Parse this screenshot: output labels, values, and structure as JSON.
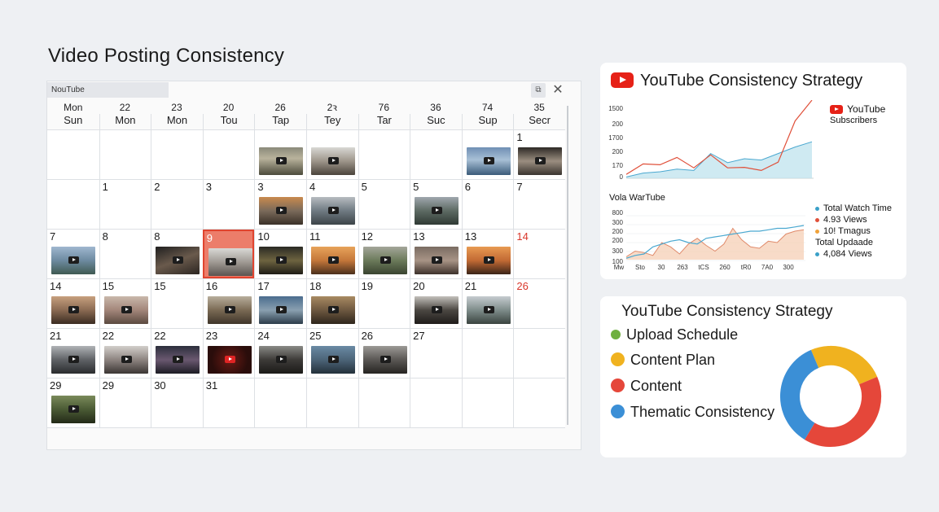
{
  "page_title": "Video Posting Consistency",
  "calendar": {
    "tab_label": "NouTube",
    "restore_label": "⧉",
    "close_label": "✕",
    "header_numbers": [
      "Mon",
      "22",
      "23",
      "20",
      "26",
      "2ꝛ",
      "76",
      "36",
      "74",
      "35"
    ],
    "header_days": [
      "Sun",
      "Mon",
      "Mon",
      "Tou",
      "Tap",
      "Tey",
      "Tar",
      "Suc",
      "Sup",
      "Secr"
    ],
    "weeks": [
      [
        {
          "n": ""
        },
        {
          "n": ""
        },
        {
          "n": ""
        },
        {
          "n": ""
        },
        {
          "n": "",
          "t": "a"
        },
        {
          "n": "",
          "t": "b"
        },
        {
          "n": ""
        },
        {
          "n": ""
        },
        {
          "n": "",
          "t": "c"
        },
        {
          "n": "1",
          "t": "d"
        }
      ],
      [
        {
          "n": ""
        },
        {
          "n": "1"
        },
        {
          "n": "2"
        },
        {
          "n": "3"
        },
        {
          "n": "3",
          "t": "e"
        },
        {
          "n": "4",
          "t": "f"
        },
        {
          "n": "5"
        },
        {
          "n": "5",
          "t": "g"
        },
        {
          "n": "6"
        },
        {
          "n": "7"
        }
      ],
      [
        {
          "n": "7",
          "t": "h"
        },
        {
          "n": "8"
        },
        {
          "n": "8",
          "t": "i"
        },
        {
          "n": "9",
          "t": "j",
          "hl": true
        },
        {
          "n": "10",
          "t": "k"
        },
        {
          "n": "11",
          "t": "l"
        },
        {
          "n": "12",
          "t": "m"
        },
        {
          "n": "13",
          "t": "n"
        },
        {
          "n": "13",
          "t": "o"
        },
        {
          "n": "14",
          "red": true
        }
      ],
      [
        {
          "n": "14",
          "t": "p"
        },
        {
          "n": "15",
          "t": "q"
        },
        {
          "n": "15"
        },
        {
          "n": "16",
          "t": "r"
        },
        {
          "n": "17",
          "t": "s"
        },
        {
          "n": "18",
          "t": "t"
        },
        {
          "n": "19"
        },
        {
          "n": "20",
          "t": "u"
        },
        {
          "n": "21",
          "t": "v"
        },
        {
          "n": "26",
          "red": true
        }
      ],
      [
        {
          "n": "21",
          "t": "w"
        },
        {
          "n": "22",
          "t": "x"
        },
        {
          "n": "22",
          "t": "y"
        },
        {
          "n": "23",
          "t": "yt"
        },
        {
          "n": "24",
          "t": "z"
        },
        {
          "n": "25",
          "t": "aa"
        },
        {
          "n": "26",
          "t": "bb"
        },
        {
          "n": "27"
        },
        {
          "n": ""
        },
        {
          "n": ""
        }
      ],
      [
        {
          "n": "29",
          "t": "cc"
        },
        {
          "n": "29"
        },
        {
          "n": "30"
        },
        {
          "n": "31"
        },
        {
          "n": ""
        },
        {
          "n": ""
        },
        {
          "n": ""
        },
        {
          "n": ""
        },
        {
          "n": ""
        },
        {
          "n": ""
        }
      ]
    ]
  },
  "strategy_chart": {
    "title": "YouTube Consistency Strategy",
    "legend_brand": "YouTube",
    "legend_sub": "Subscribers",
    "y_ticks_top": [
      "1500",
      "200",
      "1700",
      "200",
      "170",
      "0"
    ],
    "section_label": "Vola WarTube",
    "y_ticks_bottom": [
      "800",
      "300",
      "200",
      "200",
      "300",
      "100"
    ],
    "x_ticks": [
      "Mw",
      "Sto",
      "30",
      "263",
      "tCS",
      "260",
      "tR0",
      "7A0",
      "300"
    ],
    "legend": [
      {
        "label": "Total Watch Time",
        "color": "#3aa0c8"
      },
      {
        "label": "4.93 Views",
        "color": "#e0503a"
      },
      {
        "label": "10! Tmagus",
        "color": "#f0a23a"
      },
      {
        "label": "Total Updaade",
        "color": ""
      },
      {
        "label": "4,084 Views",
        "color": "#3aa0c8"
      }
    ],
    "colors": {
      "red": "#e0503a",
      "blue": "#4aa8d0",
      "blue_fill": "#bfe3ee",
      "orange_fill": "#f6cfb6"
    }
  },
  "chart_data": [
    {
      "type": "area",
      "title": "YouTube Consistency Strategy",
      "x": [
        1,
        2,
        3,
        4,
        5,
        6,
        7,
        8,
        9,
        10,
        11,
        12
      ],
      "series": [
        {
          "name": "YouTube",
          "values": [
            15,
            55,
            52,
            80,
            40,
            90,
            40,
            42,
            30,
            62,
            220,
            300
          ]
        },
        {
          "name": "Subscribers",
          "values": [
            5,
            20,
            25,
            35,
            30,
            95,
            60,
            75,
            70,
            95,
            120,
            140
          ]
        }
      ],
      "ylim": [
        0,
        300
      ]
    },
    {
      "type": "area",
      "title": "Vola WarTube",
      "x": [
        1,
        2,
        3,
        4,
        5,
        6,
        7,
        8,
        9,
        10,
        11,
        12,
        13,
        14,
        15,
        16,
        17,
        18,
        19,
        20,
        21
      ],
      "series": [
        {
          "name": "4.93 Views",
          "values": [
            10,
            30,
            25,
            15,
            60,
            45,
            20,
            55,
            75,
            50,
            30,
            55,
            110,
            70,
            45,
            40,
            65,
            60,
            90,
            100,
            105
          ]
        },
        {
          "name": "Total Watch Time",
          "values": [
            5,
            15,
            20,
            45,
            55,
            65,
            70,
            60,
            55,
            75,
            80,
            85,
            90,
            95,
            100,
            100,
            105,
            110,
            110,
            115,
            120
          ]
        }
      ],
      "ylim": [
        0,
        160
      ]
    },
    {
      "type": "pie",
      "title": "YouTube Consistency Strategy",
      "categories": [
        "Upload Schedule",
        "Content Plan",
        "Content",
        "Thematic Consistency"
      ],
      "values": [
        0,
        25,
        40,
        35
      ]
    }
  ],
  "donut_panel": {
    "title": "YouTube Consistency Strategy",
    "items": [
      {
        "label": "Upload Schedule",
        "color": "#6fb03f"
      },
      {
        "label": "Content Plan",
        "color": "#f0b21f"
      },
      {
        "label": "Content",
        "color": "#e5473a"
      },
      {
        "label": "Thematic Consistency",
        "color": "#3b8fd6"
      }
    ]
  }
}
